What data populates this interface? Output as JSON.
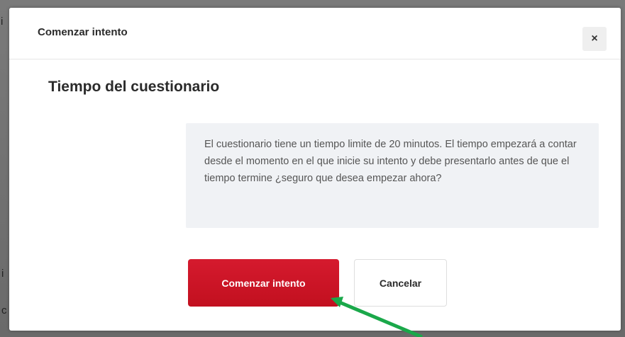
{
  "modal": {
    "title": "Comenzar intento",
    "close_symbol": "×",
    "section_title": "Tiempo del cuestionario",
    "info_text": "El cuestionario tiene un tiempo limite de 20 minutos. El tiempo empezará a contar desde el momento en el que inicie su intento y debe presentarlo antes de que el tiempo termine ¿seguro que desea empezar ahora?",
    "primary_button": "Comenzar intento",
    "secondary_button": "Cancelar"
  },
  "background": {
    "glyph_top": "i",
    "glyph_mid": "i",
    "glyph_bottom": "c"
  },
  "colors": {
    "primary": "#c8141f",
    "annotation_arrow": "#1aa84a"
  },
  "icons": {
    "close": "close-icon",
    "annotation": "arrow-annotation"
  }
}
